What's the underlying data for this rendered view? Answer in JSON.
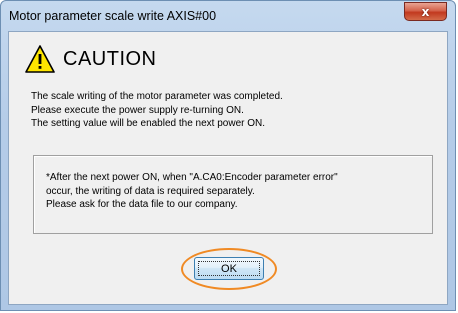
{
  "window": {
    "title": "Motor parameter scale write AXIS#00",
    "close_label": "x"
  },
  "dialog": {
    "heading": "CAUTION",
    "icon": "warning-triangle-icon",
    "messages": [
      "The scale writing of the motor parameter was completed.",
      "Please execute the power supply re-turning ON.",
      "The setting value will be enabled the next power ON."
    ],
    "note_lines": [
      "*After the next power ON, when \"A.CA0:Encoder parameter error\"",
      " occur, the writing of data is required separately.",
      " Please ask for the data file to our company."
    ],
    "ok_label": "OK"
  },
  "colors": {
    "highlight": "#f08a24",
    "warning_fill": "#ffe600"
  }
}
